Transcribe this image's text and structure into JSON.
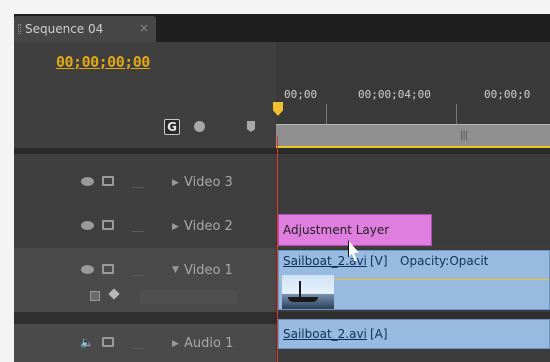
{
  "tab": {
    "title": "Sequence 04",
    "close": "×"
  },
  "header": {
    "timecode": "00;00;00;00"
  },
  "ruler": {
    "labels": [
      "00;00",
      "00;00;04;00",
      "00;00;0"
    ],
    "grip": "|||"
  },
  "tracks": [
    {
      "name": "Video 3",
      "type": "video",
      "expanded": false
    },
    {
      "name": "Video 2",
      "type": "video",
      "expanded": false
    },
    {
      "name": "Video 1",
      "type": "video",
      "expanded": true
    },
    {
      "name": "Audio 1",
      "type": "audio",
      "expanded": false
    }
  ],
  "clips": {
    "adjustment": {
      "label": "Adjustment Layer",
      "color": "#e07ee0"
    },
    "video1": {
      "name": "Sailboat_2.avi",
      "tag": "[V]",
      "opacity": "Opacity:Opacit",
      "color": "#98b9e0"
    },
    "audio1": {
      "name": "Sailboat_2.avi",
      "tag": "[A]",
      "color": "#98b9e0"
    }
  },
  "colors": {
    "timecode": "#e0a817",
    "playhead": "#e23a2a",
    "workarea": "#e8c820"
  },
  "icons": [
    "eye-icon",
    "film-icon",
    "speaker-icon",
    "snap-icon",
    "marker-icon",
    "flag-icon",
    "triangle-right-icon",
    "triangle-down-icon"
  ]
}
